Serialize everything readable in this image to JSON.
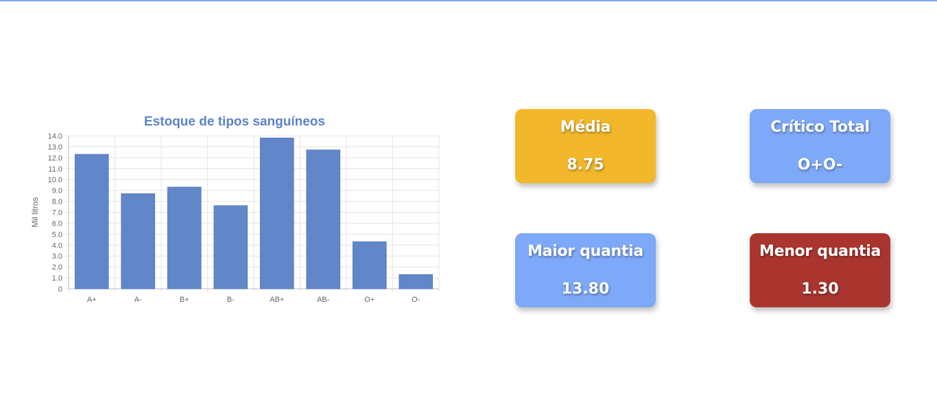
{
  "chart_data": {
    "type": "bar",
    "title": "Estoque de tipos sanguíneos",
    "ylabel": "Mil litros",
    "xlabel": "",
    "categories": [
      "A+",
      "A-",
      "B+",
      "B-",
      "AB+",
      "AB-",
      "O+",
      "O-"
    ],
    "values": [
      12.3,
      8.7,
      9.3,
      7.6,
      13.8,
      12.7,
      4.3,
      1.3
    ],
    "ylim": [
      0,
      14
    ],
    "yticks": [
      "0",
      "1.0",
      "2.0",
      "3.0",
      "4.0",
      "5.0",
      "6.0",
      "7.0",
      "8.0",
      "9.0",
      "10.0",
      "11.0",
      "12.0",
      "13.0",
      "14.0"
    ],
    "grid": true,
    "legend": "none",
    "colors": {
      "bar": "#6287c9",
      "title": "#5b82c9",
      "grid": "#e4e4e4",
      "tick_text": "#666666"
    }
  },
  "cards": {
    "media": {
      "title": "Média",
      "value": "8.75",
      "color": "#f2b72b"
    },
    "critico": {
      "title": "Crítico Total",
      "value": "O+O-",
      "color": "#7ea8f8"
    },
    "maior": {
      "title": "Maior quantia",
      "value": "13.80",
      "color": "#7ea8f8"
    },
    "menor": {
      "title": "Menor quantia",
      "value": "1.30",
      "color": "#aa352e"
    }
  },
  "theme": {
    "top_line": "#7fa7f5"
  }
}
